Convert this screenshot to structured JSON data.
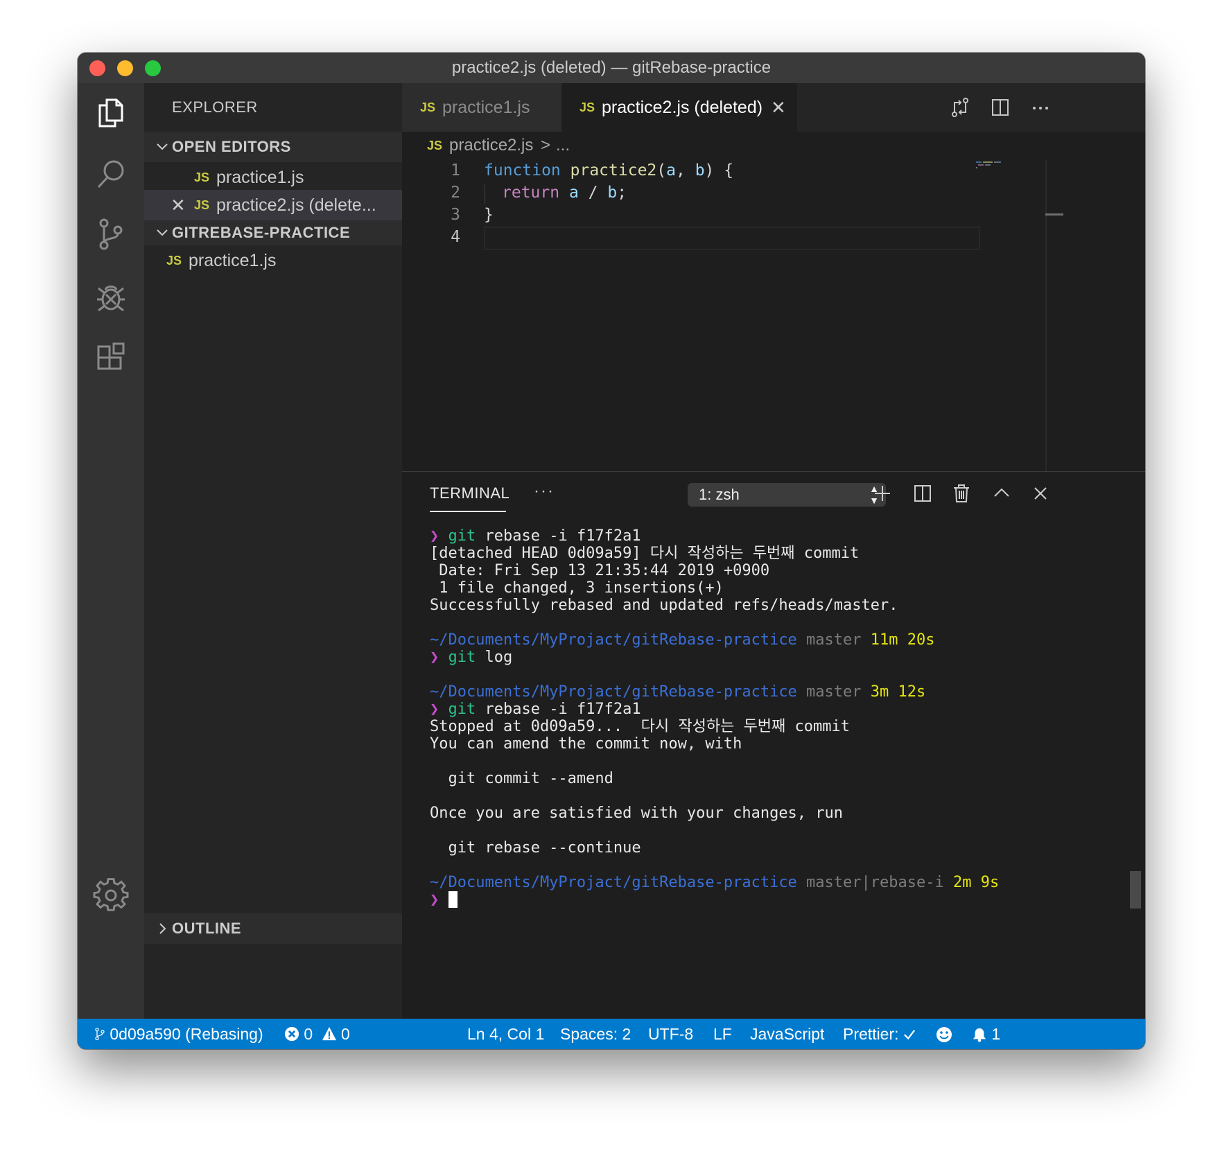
{
  "window": {
    "title": "practice2.js (deleted) — gitRebase-practice"
  },
  "colors": {
    "status_bar": "#007acc",
    "js_icon": "#cbcb41",
    "accent_terminal_prompt": "#c64dcb"
  },
  "activity_bar": {
    "icons": [
      "explorer-icon",
      "search-icon",
      "source-control-icon",
      "debug-icon",
      "extensions-icon",
      "settings-gear-icon"
    ]
  },
  "sidebar": {
    "title": "EXPLORER",
    "open_editors": {
      "label": "OPEN EDITORS",
      "items": [
        {
          "icon": "JS",
          "name": "practice1.js"
        },
        {
          "icon": "JS",
          "name": "practice2.js (delete..."
        }
      ]
    },
    "project": {
      "label": "GITREBASE-PRACTICE",
      "items": [
        {
          "icon": "JS",
          "name": "practice1.js"
        }
      ]
    },
    "outline": {
      "label": "OUTLINE"
    }
  },
  "tabs": [
    {
      "icon": "JS",
      "name": "practice1.js",
      "active": false
    },
    {
      "icon": "JS",
      "name": "practice2.js (deleted)",
      "active": true
    }
  ],
  "breadcrumb": {
    "icon": "JS",
    "file": "practice2.js",
    "sep": ">",
    "rest": "..."
  },
  "editor": {
    "line_numbers": [
      "1",
      "2",
      "3",
      "4"
    ],
    "lines": {
      "l1": {
        "kw": "function",
        "fn": "practice2",
        "p1": "(",
        "a": "a",
        "comma": ", ",
        "b": "b",
        "p2": ") {"
      },
      "l2": {
        "ret": "return",
        "a": "a",
        "op": " / ",
        "b": "b",
        "end": ";"
      },
      "l3": {
        "text": "}"
      }
    }
  },
  "panel": {
    "title": "TERMINAL",
    "more": "···",
    "shell_select": "1: zsh",
    "actions": [
      "plus-icon",
      "split-terminal-icon",
      "trash-icon",
      "chevron-up-icon",
      "close-icon"
    ]
  },
  "terminal": {
    "prompt_char": "❯",
    "git": "git",
    "path": "~/Documents/MyProjact/gitRebase-practice",
    "cmd_rebase": " rebase -i f17f2a1",
    "cmd_log": " log",
    "out1": "[detached HEAD 0d09a59] 다시 작성하는 두번째 commit",
    "out2": " Date: Fri Sep 13 21:35:44 2019 +0900",
    "out3": " 1 file changed, 3 insertions(+)",
    "out4": "Successfully rebased and updated refs/heads/master.",
    "branch1": " master ",
    "time1": "11m 20s",
    "branch2": " master ",
    "time2": "3m 12s",
    "out5": "Stopped at 0d09a59...  다시 작성하는 두번째 commit",
    "out6": "You can amend the commit now, with",
    "out7": "  git commit --amend",
    "out8": "Once you are satisfied with your changes, run",
    "out9": "  git rebase --continue",
    "branch3": " master|rebase-i ",
    "time3": "2m 9s"
  },
  "status_bar": {
    "branch": "0d09a590 (Rebasing)",
    "errors": "0",
    "warnings": "0",
    "position": "Ln 4, Col 1",
    "spaces": "Spaces: 2",
    "encoding": "UTF-8",
    "eol": "LF",
    "language": "JavaScript",
    "prettier": "Prettier:",
    "notifications": "1"
  }
}
